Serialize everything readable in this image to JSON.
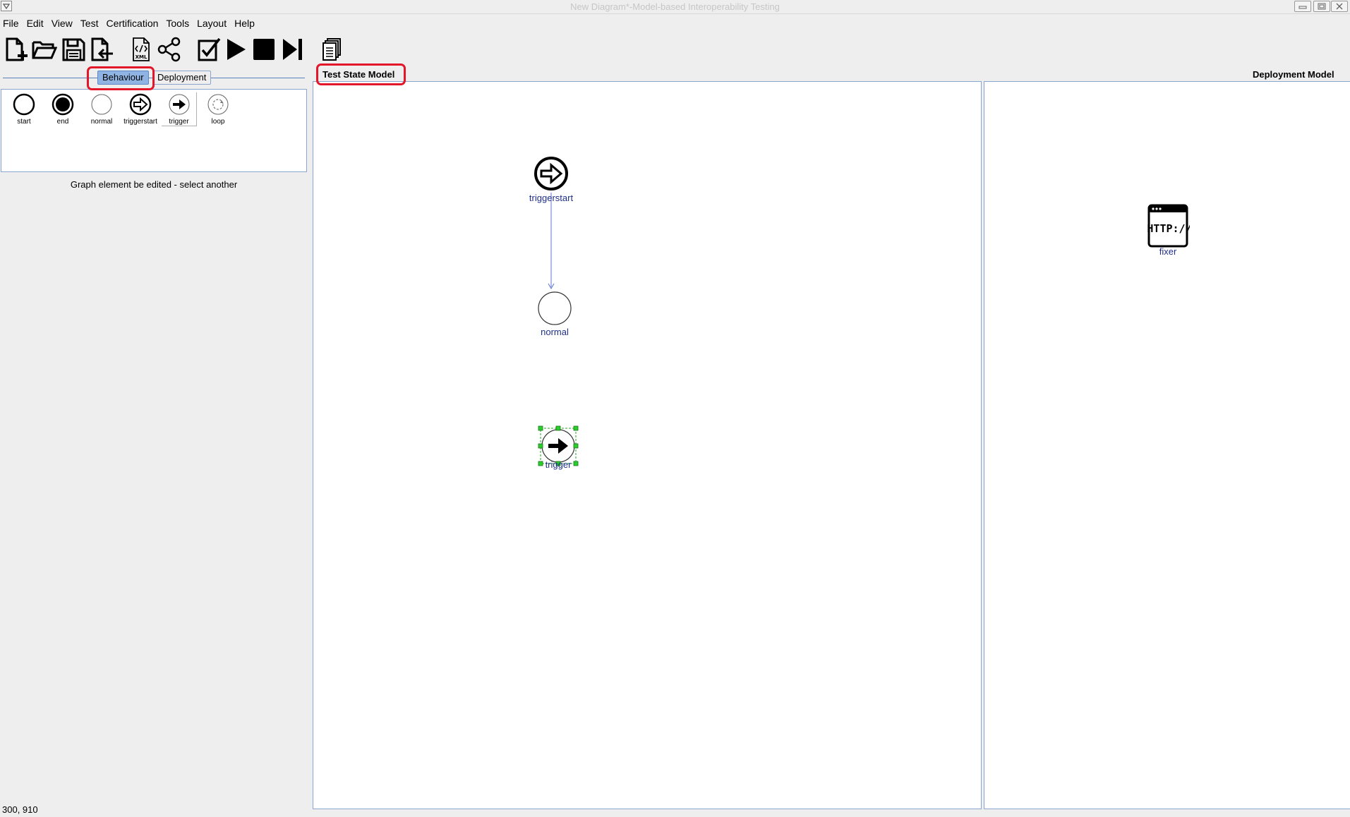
{
  "window": {
    "title": "New Diagram*-Model-based Interoperability Testing",
    "sysmenu_icon": "chevron-down-icon",
    "buttons": [
      "minimize-icon",
      "restore-icon",
      "close-icon"
    ]
  },
  "menubar": {
    "items": [
      "File",
      "Edit",
      "View",
      "Test",
      "Certification",
      "Tools",
      "Layout",
      "Help"
    ]
  },
  "toolbar": {
    "items": [
      {
        "name": "new-document-icon"
      },
      {
        "name": "open-folder-icon"
      },
      {
        "name": "save-icon"
      },
      {
        "name": "export-document-icon"
      },
      {
        "name": "xml-file-icon",
        "label": "XML"
      },
      {
        "name": "share-graph-icon"
      },
      {
        "name": "check-icon"
      },
      {
        "name": "play-icon"
      },
      {
        "name": "stop-icon"
      },
      {
        "name": "step-forward-icon"
      },
      {
        "name": "copy-documents-icon"
      }
    ]
  },
  "left_panel": {
    "tabs": [
      {
        "label": "Behaviour",
        "active": true
      },
      {
        "label": "Deployment",
        "active": false
      }
    ],
    "palette": [
      {
        "label": "start",
        "icon": "start-circle-icon"
      },
      {
        "label": "end",
        "icon": "end-circle-icon"
      },
      {
        "label": "normal",
        "icon": "normal-circle-icon"
      },
      {
        "label": "triggerstart",
        "icon": "triggerstart-icon"
      },
      {
        "label": "trigger",
        "icon": "trigger-icon"
      },
      {
        "label": "loop",
        "icon": "loop-icon"
      }
    ],
    "status_message": "Graph element be edited - select another"
  },
  "test_state_model": {
    "title": "Test State Model",
    "nodes": [
      {
        "label": "triggerstart",
        "type": "triggerstart"
      },
      {
        "label": "normal",
        "type": "normal"
      },
      {
        "label": "trigger",
        "type": "trigger",
        "selected": true
      }
    ],
    "edges": [
      {
        "from": "triggerstart",
        "to": "normal"
      }
    ]
  },
  "deployment_model": {
    "title": "Deployment Model",
    "nodes": [
      {
        "label": "fixer",
        "icon_text": "HTTP://"
      }
    ]
  },
  "status_bar": {
    "coordinates": "300, 910"
  },
  "colors": {
    "highlight": "#e4162a",
    "node_label": "#1f2f8a",
    "edge": "#5b74d6",
    "selection": "#22aa22",
    "active_tab": "#8fb4e3"
  }
}
